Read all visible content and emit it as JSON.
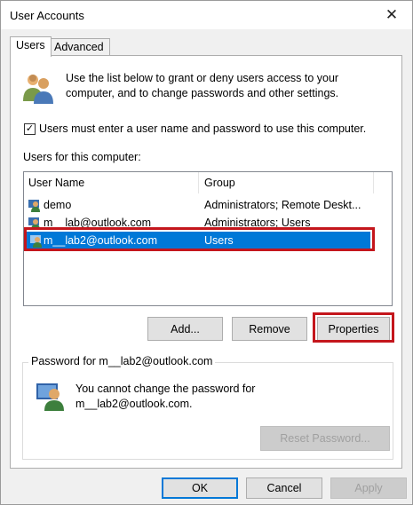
{
  "window": {
    "title": "User Accounts",
    "close_icon": "close-icon"
  },
  "tabs": [
    {
      "label": "Users",
      "active": true
    },
    {
      "label": "Advanced",
      "active": false
    }
  ],
  "intro": {
    "icon": "users-icon",
    "text": "Use the list below to grant or deny users access to your computer, and to change passwords and other settings."
  },
  "require_login": {
    "checked": true,
    "check_glyph": "✓",
    "label": "Users must enter a user name and password to use this computer."
  },
  "users_section": {
    "label": "Users for this computer:",
    "columns": [
      "User Name",
      "Group"
    ],
    "rows": [
      {
        "name": "demo",
        "group": "Administrators; Remote Deskt...",
        "selected": false
      },
      {
        "name": "m__lab@outlook.com",
        "group": "Administrators; Users",
        "selected": false
      },
      {
        "name": "m__lab2@outlook.com",
        "group": "Users",
        "selected": true
      }
    ]
  },
  "list_buttons": {
    "add": "Add...",
    "remove": "Remove",
    "properties": "Properties"
  },
  "password_group": {
    "legend": "Password for m__lab2@outlook.com",
    "icon": "user-icon",
    "line1": "You cannot change the password for",
    "line2": "m__lab2@outlook.com.",
    "reset_button": "Reset Password..."
  },
  "dialog_buttons": {
    "ok": "OK",
    "cancel": "Cancel",
    "apply": "Apply"
  },
  "colors": {
    "selection": "#0078d7",
    "highlight_box": "#c4161c",
    "window_bg": "#f0f0f0"
  }
}
